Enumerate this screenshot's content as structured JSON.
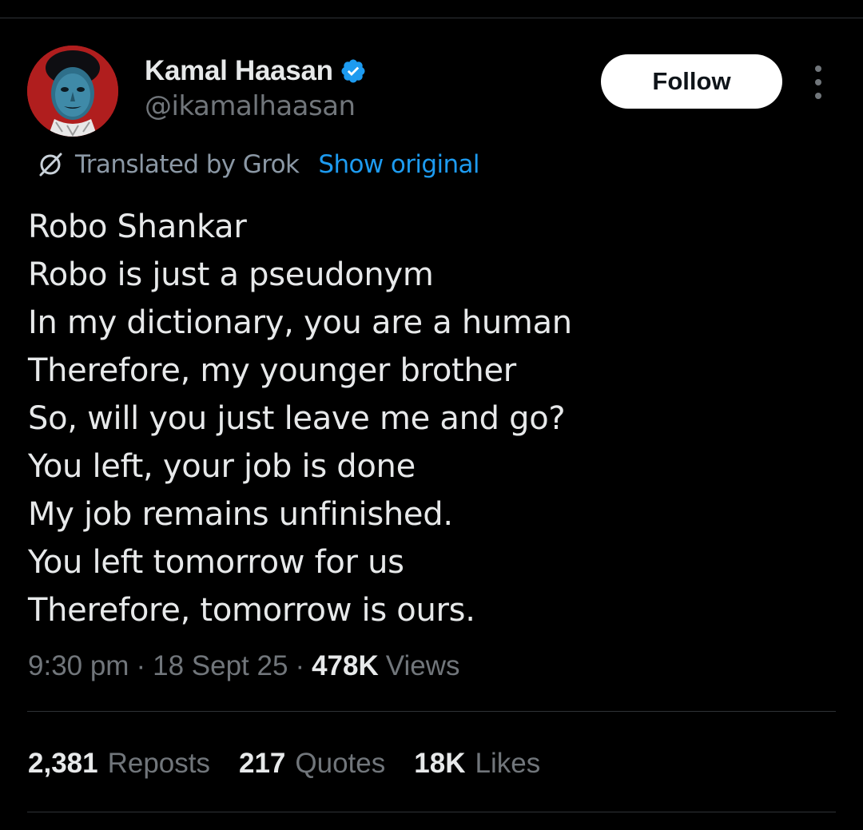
{
  "author": {
    "display_name": "Kamal Haasan",
    "handle": "@ikamalhaasan",
    "verified": true,
    "avatar_icon": "profile-portrait",
    "avatar_bg_color": "#b01e1e"
  },
  "actions": {
    "follow_label": "Follow",
    "more_icon": "more-dots-icon"
  },
  "translation": {
    "label": "Translated by Grok",
    "show_original_label": "Show original",
    "icon": "grok-icon"
  },
  "tweet": {
    "lines": [
      "Robo Shankar",
      "Robo is just a pseudonym",
      "In my dictionary, you are a human",
      "Therefore, my younger brother",
      "So, will you just leave me and go?",
      "You left, your job is done",
      "My job remains unfinished.",
      "You left tomorrow for us",
      "Therefore, tomorrow is ours."
    ]
  },
  "meta": {
    "time": "9:30 pm",
    "separator": "·",
    "date": "18 Sept 25",
    "views_count": "478K",
    "views_label": "Views"
  },
  "stats": {
    "reposts_count": "2,381",
    "reposts_label": "Reposts",
    "quotes_count": "217",
    "quotes_label": "Quotes",
    "likes_count": "18K",
    "likes_label": "Likes"
  },
  "colors": {
    "background": "#000000",
    "primary_text": "#e7e9ea",
    "secondary_text": "#71767b",
    "link": "#1d9bf0",
    "verified_badge": "#1d9bf0",
    "divider": "#2f3336"
  }
}
